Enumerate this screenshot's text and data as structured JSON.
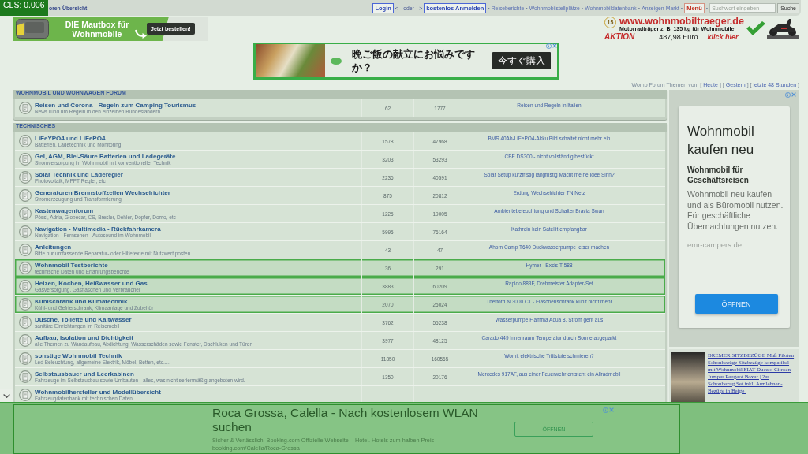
{
  "cls_badge": "CLS: 0.006",
  "top_bar": {
    "breadcrumb": "oren-Übersicht",
    "items": [
      {
        "kind": "button",
        "text": "Login"
      },
      {
        "kind": "text",
        "text": "<-- oder -->"
      },
      {
        "kind": "button",
        "text": "kostenlos Anmelden"
      },
      {
        "kind": "sep",
        "text": "•"
      },
      {
        "kind": "link",
        "text": "Reiseberichte"
      },
      {
        "kind": "sep",
        "text": "•"
      },
      {
        "kind": "link",
        "text": "Wohnmobilstellplätze"
      },
      {
        "kind": "sep",
        "text": "•"
      },
      {
        "kind": "link",
        "text": "Wohnmobildatenbank"
      },
      {
        "kind": "sep",
        "text": "•"
      },
      {
        "kind": "link",
        "text": "Anzeigen-Markt"
      },
      {
        "kind": "sep",
        "text": "•"
      },
      {
        "kind": "menu",
        "text": "Menü"
      },
      {
        "kind": "sep",
        "text": "•"
      }
    ],
    "search": {
      "placeholder": "Suchwort eingeben",
      "button": "Suche"
    }
  },
  "mautbox_ad": {
    "headline": "DIE Mautbox für Wohnmobile",
    "button": "Jetzt bestellen!"
  },
  "traeger_ad": {
    "badge": "15",
    "url": "www.wohnmobiltraeger.de",
    "tagline": "Motorradträger z. B. 135 kg für Wohnmobile",
    "promo": "AKTION",
    "price": "487,98 Euro",
    "cta": "klick hier"
  },
  "meal_ad": {
    "headline": "晩ご飯の献立にお悩みですか？",
    "button": "今すぐ購入"
  },
  "topic_filter": [
    {
      "kind": "text",
      "text": "Womo Forum Themen von: ["
    },
    {
      "kind": "link",
      "text": "Heute"
    },
    {
      "kind": "text",
      "text": "] ["
    },
    {
      "kind": "link",
      "text": "Gestern"
    },
    {
      "kind": "text",
      "text": "] ["
    },
    {
      "kind": "link",
      "text": "letzte 48 Stunden"
    },
    {
      "kind": "text",
      "text": "]"
    }
  ],
  "forum": {
    "categories": [
      {
        "title": "WOHNMOBIL UND WOHNWAGEN FORUM",
        "forums": [
          {
            "title": "Reisen und Corona - Regeln zum Camping Tourismus",
            "description": "News rund um Regeln in den einzelnen Bundesländern",
            "topics": "62",
            "posts": "1777",
            "last_post": "Reisen und Regeln in Italien",
            "highlighted": false
          }
        ]
      },
      {
        "title": "TECHNISCHES",
        "forums": [
          {
            "title": "LiFeYPO4 und LiFePO4",
            "description": "Batterien, Ladetechnik und Monitoring",
            "topics": "1578",
            "posts": "47968",
            "last_post": "BMS 40Ah-LiFePO4-Akku Bild schaltet nicht mehr ein",
            "highlighted": false
          },
          {
            "title": "Gel, AGM, Blei-Säure Batterien und Ladegeräte",
            "description": "Stromversorgung im Wohnmobil mit konventioneller Technik",
            "topics": "3203",
            "posts": "53293",
            "last_post": "CBE DS300 - nicht vollständig bestückt",
            "highlighted": false
          },
          {
            "title": "Solar Technik und Laderegler",
            "description": "Photovoltaik, MPPT Regler, etc",
            "topics": "2236",
            "posts": "40591",
            "last_post": "Solar Setup kurzfristig langfristig Macht meine Idee Sinn?",
            "highlighted": false
          },
          {
            "title": "Generatoren Brennstoffzellen Wechselrichter",
            "description": "Stromerzeugung und Transformierung",
            "topics": "875",
            "posts": "20812",
            "last_post": "Erdung Wechselrichter TN Netz",
            "highlighted": false
          },
          {
            "title": "Kastenwagenforum",
            "description": "Pössl, Adria, Globecar, CS, Bresler, Dehler, Dopfer, Domo, etc",
            "topics": "1225",
            "posts": "19005",
            "last_post": "Ambientebeleuchtung und Schalter Bravia Swan",
            "highlighted": false
          },
          {
            "title": "Navigation - Multimedia - Rückfahrkamera",
            "description": "Navigation - Fernsehen - Autosound im Wohnmobil",
            "topics": "5995",
            "posts": "76164",
            "last_post": "Kathrein kein Satellit empfangbar",
            "highlighted": false
          },
          {
            "title": "Anleitungen",
            "description": "Bitte nur umfassende Reparatur- oder Hilfetexte mit Nutzwert posten.",
            "topics": "43",
            "posts": "47",
            "last_post": "Ahorn Camp T640 Duckwasserpumpe leiser machen",
            "highlighted": false
          },
          {
            "title": "Wohnmobil Testberichte",
            "description": "technische Daten und Erfahrungsberichte",
            "topics": "36",
            "posts": "291",
            "last_post": "Hymer - Exsis-T 588",
            "highlighted": true
          },
          {
            "title": "Heizen, Kochen, Heißwasser und Gas",
            "description": "Gasversorgung, Gasflaschen und Verbraucher",
            "topics": "3883",
            "posts": "60209",
            "last_post": "Rapido 883F, Drehmeister Adapter-Set",
            "highlighted": true
          },
          {
            "title": "Kühlschrank und Klimatechnik",
            "description": "Kühl- und Gefrierschrank, Klimaanlage und Zubehör",
            "topics": "2070",
            "posts": "25024",
            "last_post": "Thetford N 3000 C1 - Flaschenschrank kühlt nicht mehr",
            "highlighted": true
          },
          {
            "title": "Dusche, Toilette und Kaltwasser",
            "description": "sanitäre Einrichtungen im Reisemobil",
            "topics": "3762",
            "posts": "55238",
            "last_post": "Wasserpumpe Fiamma Aqua 8, Strom geht aus",
            "highlighted": false
          },
          {
            "title": "Aufbau, Isolation und Dichtigkeit",
            "description": "alle Themen zu Wandaufbau, Abdichtung, Wasserschäden sowie Fenster, Dachluken und Türen",
            "topics": "3977",
            "posts": "48125",
            "last_post": "Carado 449 Innenraum Temperatur durch Sonne abgeparkt",
            "highlighted": false
          },
          {
            "title": "sonstige Wohnmobil Technik",
            "description": "Led Beleuchtung, allgemeine Elektrik, Möbel, Betten, etc.....",
            "topics": "11850",
            "posts": "160565",
            "last_post": "Womit elektrische Trittstufe schmieren?",
            "highlighted": false
          },
          {
            "title": "Selbstausbauer und Leerkabinen",
            "description": "Fahrzeuge im Selbstausbau sowie Umbauten - alles, was nicht serienmäßig angeboten wird.",
            "topics": "1350",
            "posts": "20176",
            "last_post": "Mercedes 917AF, aus einer Feuerwehr entsteht ein Allradmobil",
            "highlighted": false
          },
          {
            "title": "Wohnmobilhersteller und Modellübersicht",
            "description": "Fahrzeugdatenbank mit technischen Daten",
            "highlighted": false
          }
        ]
      }
    ]
  },
  "side_ad": {
    "headline": "Wohnmobil kaufen neu",
    "subhead": "Wohnmobil für Geschäftsreisen",
    "body": "Wohnmobil neu kaufen und als Büromobil nutzen. Für geschäftliche Übernachtungen nutzen.",
    "domain": "emr-campers.de",
    "button": "ÖFFNEN"
  },
  "product_ad": {
    "link": "BREMER SITZBEZÜGE Maß Piloten Schonbezüge Sitzbezüge kompatibel mit Wohnmobil FIAT Ducato Citroen Jumper Peugeot Boxer | 2er Schonbezug Set inkl. Armlehnen-Bezüge in Beige |"
  },
  "bottom_ad": {
    "highlighted": true,
    "headline": "Roca Grossa, Calella - Nach kostenlosem WLAN suchen",
    "body": "Sicher & Verlässlich. Booking.com Offizielle Webseite – Hotel. Hotels zum halben Preis booking.com/Calella/Roca-Grossa",
    "button": "ÖFFNEN"
  }
}
